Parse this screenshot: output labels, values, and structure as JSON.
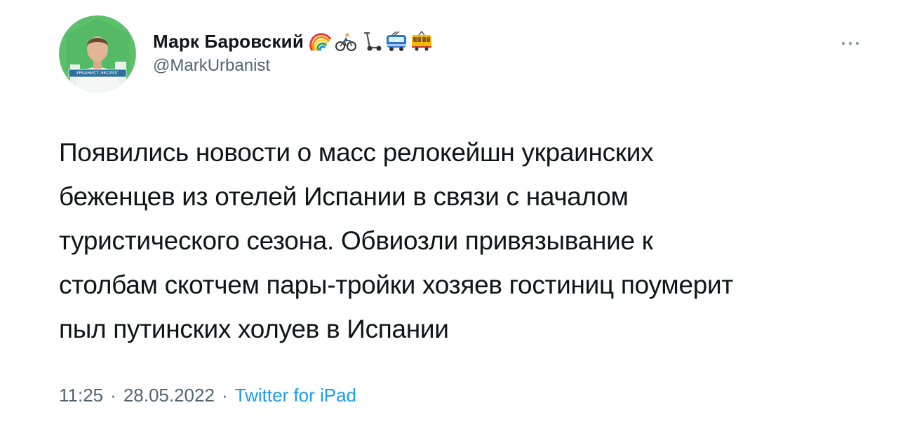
{
  "author": {
    "display_name": "Марк Баровский",
    "handle": "@MarkUrbanist",
    "avatar_badge_text": "УРБАНИСТ-ЭКОЛОГ",
    "name_emojis": [
      "rainbow-icon",
      "cyclist-icon",
      "scooter-icon",
      "trolleybus-icon",
      "tram-icon"
    ]
  },
  "tweet": {
    "text": "Появились новости о масс релокейшн украинских\nбеженцев из отелей Испании в связи с началом\nтуристического сезона. Обвиозли привязывание к\nстолбам скотчем пары-тройки хозяев гостиниц поумерит\nпыл путинских холуев в Испании"
  },
  "meta": {
    "time": "11:25",
    "date": "28.05.2022",
    "source": "Twitter for iPad",
    "separator": "·"
  },
  "colors": {
    "text_primary": "#0f1419",
    "text_secondary": "#536471",
    "link": "#1d9bf0",
    "avatar_bg": "#5cc06a"
  }
}
